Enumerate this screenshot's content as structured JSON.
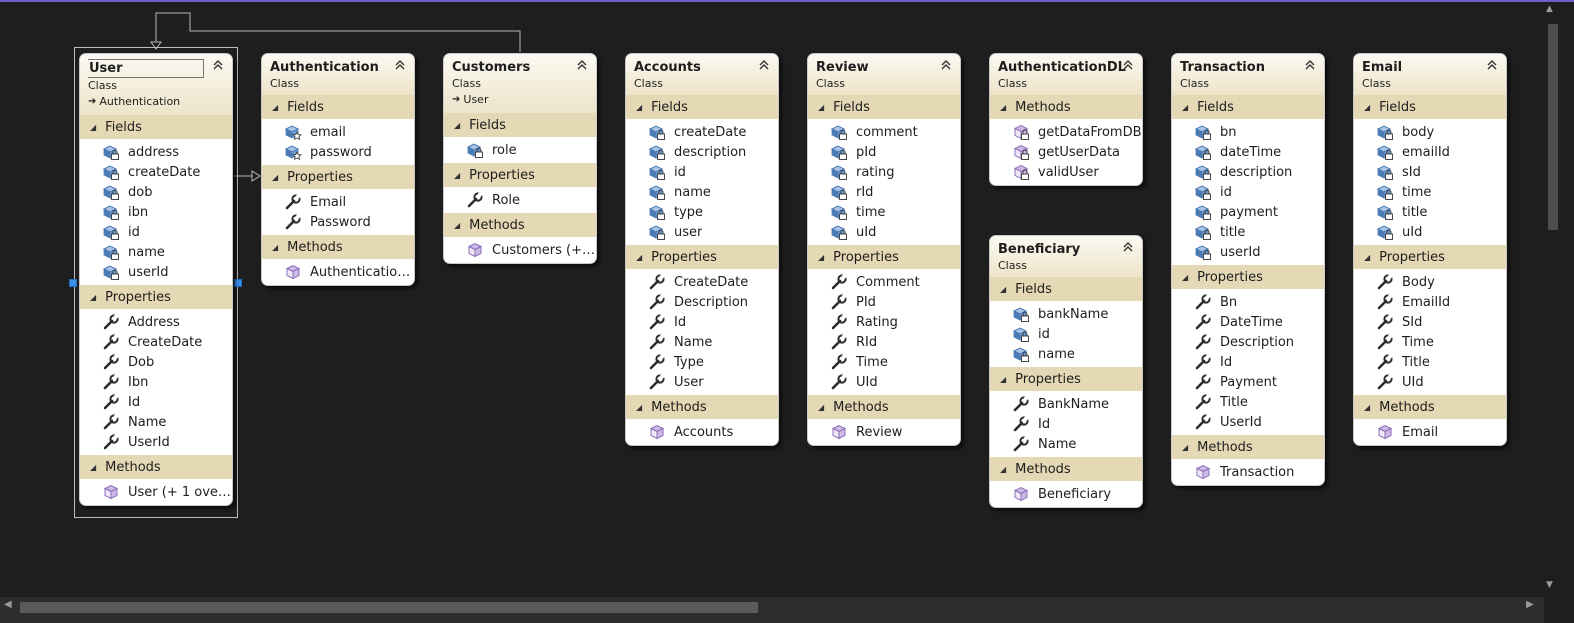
{
  "diagram": {
    "classes": [
      {
        "name": "User",
        "stereotype": "Class",
        "inherits": "Authentication",
        "selected": true,
        "sections": [
          {
            "title": "Fields",
            "kind": "field",
            "members": [
              "address",
              "createDate",
              "dob",
              "ibn",
              "id",
              "name",
              "userId"
            ]
          },
          {
            "title": "Properties",
            "kind": "property",
            "members": [
              "Address",
              "CreateDate",
              "Dob",
              "Ibn",
              "Id",
              "Name",
              "UserId"
            ]
          },
          {
            "title": "Methods",
            "kind": "method",
            "members": [
              "User (+ 1 overl..."
            ]
          }
        ]
      },
      {
        "name": "Authentication",
        "stereotype": "Class",
        "sections": [
          {
            "title": "Fields",
            "kind": "field-star",
            "members": [
              "email",
              "password"
            ]
          },
          {
            "title": "Properties",
            "kind": "property",
            "members": [
              "Email",
              "Password"
            ]
          },
          {
            "title": "Methods",
            "kind": "method",
            "members": [
              "Authentication..."
            ]
          }
        ]
      },
      {
        "name": "Customers",
        "stereotype": "Class",
        "inherits": "User",
        "sections": [
          {
            "title": "Fields",
            "kind": "field",
            "members": [
              "role"
            ]
          },
          {
            "title": "Properties",
            "kind": "property",
            "members": [
              "Role"
            ]
          },
          {
            "title": "Methods",
            "kind": "method",
            "members": [
              "Customers (+ 1..."
            ]
          }
        ]
      },
      {
        "name": "Accounts",
        "stereotype": "Class",
        "sections": [
          {
            "title": "Fields",
            "kind": "field",
            "members": [
              "createDate",
              "description",
              "id",
              "name",
              "type",
              "user"
            ]
          },
          {
            "title": "Properties",
            "kind": "property",
            "members": [
              "CreateDate",
              "Description",
              "Id",
              "Name",
              "Type",
              "User"
            ]
          },
          {
            "title": "Methods",
            "kind": "method",
            "members": [
              "Accounts"
            ]
          }
        ]
      },
      {
        "name": "Review",
        "stereotype": "Class",
        "sections": [
          {
            "title": "Fields",
            "kind": "field",
            "members": [
              "comment",
              "pId",
              "rating",
              "rId",
              "time",
              "uId"
            ]
          },
          {
            "title": "Properties",
            "kind": "property",
            "members": [
              "Comment",
              "PId",
              "Rating",
              "RId",
              "Time",
              "UId"
            ]
          },
          {
            "title": "Methods",
            "kind": "method",
            "members": [
              "Review"
            ]
          }
        ]
      },
      {
        "name": "AuthenticationDL",
        "stereotype": "Class",
        "sections": [
          {
            "title": "Methods",
            "kind": "method-static",
            "members": [
              "getDataFromDB",
              "getUserData",
              "validUser"
            ]
          }
        ]
      },
      {
        "name": "Beneficiary",
        "stereotype": "Class",
        "sections": [
          {
            "title": "Fields",
            "kind": "field",
            "members": [
              "bankName",
              "id",
              "name"
            ]
          },
          {
            "title": "Properties",
            "kind": "property",
            "members": [
              "BankName",
              "Id",
              "Name"
            ]
          },
          {
            "title": "Methods",
            "kind": "method",
            "members": [
              "Beneficiary"
            ]
          }
        ]
      },
      {
        "name": "Transaction",
        "stereotype": "Class",
        "sections": [
          {
            "title": "Fields",
            "kind": "field",
            "members": [
              "bn",
              "dateTime",
              "description",
              "id",
              "payment",
              "title",
              "userId"
            ]
          },
          {
            "title": "Properties",
            "kind": "property",
            "members": [
              "Bn",
              "DateTime",
              "Description",
              "Id",
              "Payment",
              "Title",
              "UserId"
            ]
          },
          {
            "title": "Methods",
            "kind": "method",
            "members": [
              "Transaction"
            ]
          }
        ]
      },
      {
        "name": "Email",
        "stereotype": "Class",
        "sections": [
          {
            "title": "Fields",
            "kind": "field",
            "members": [
              "body",
              "emailId",
              "sId",
              "time",
              "title",
              "uId"
            ]
          },
          {
            "title": "Properties",
            "kind": "property",
            "members": [
              "Body",
              "EmailId",
              "SId",
              "Time",
              "Title",
              "UId"
            ]
          },
          {
            "title": "Methods",
            "kind": "method",
            "members": [
              "Email"
            ]
          }
        ]
      }
    ]
  },
  "colors": {
    "background": "#1e1e1e",
    "header_gradient_end": "#ede4c9",
    "section_band": "#e5d8b5",
    "accent_bar": "#6b5fc7",
    "selection_handle": "#3b8eea"
  },
  "icons": {
    "field": "field-lock-icon",
    "field-star": "field-star-icon",
    "property": "wrench-icon",
    "method": "method-cube-icon",
    "method-static": "method-lock-icon",
    "inherits": "inheritance-arrow-icon",
    "collapse": "collapse-chevron-icon"
  }
}
